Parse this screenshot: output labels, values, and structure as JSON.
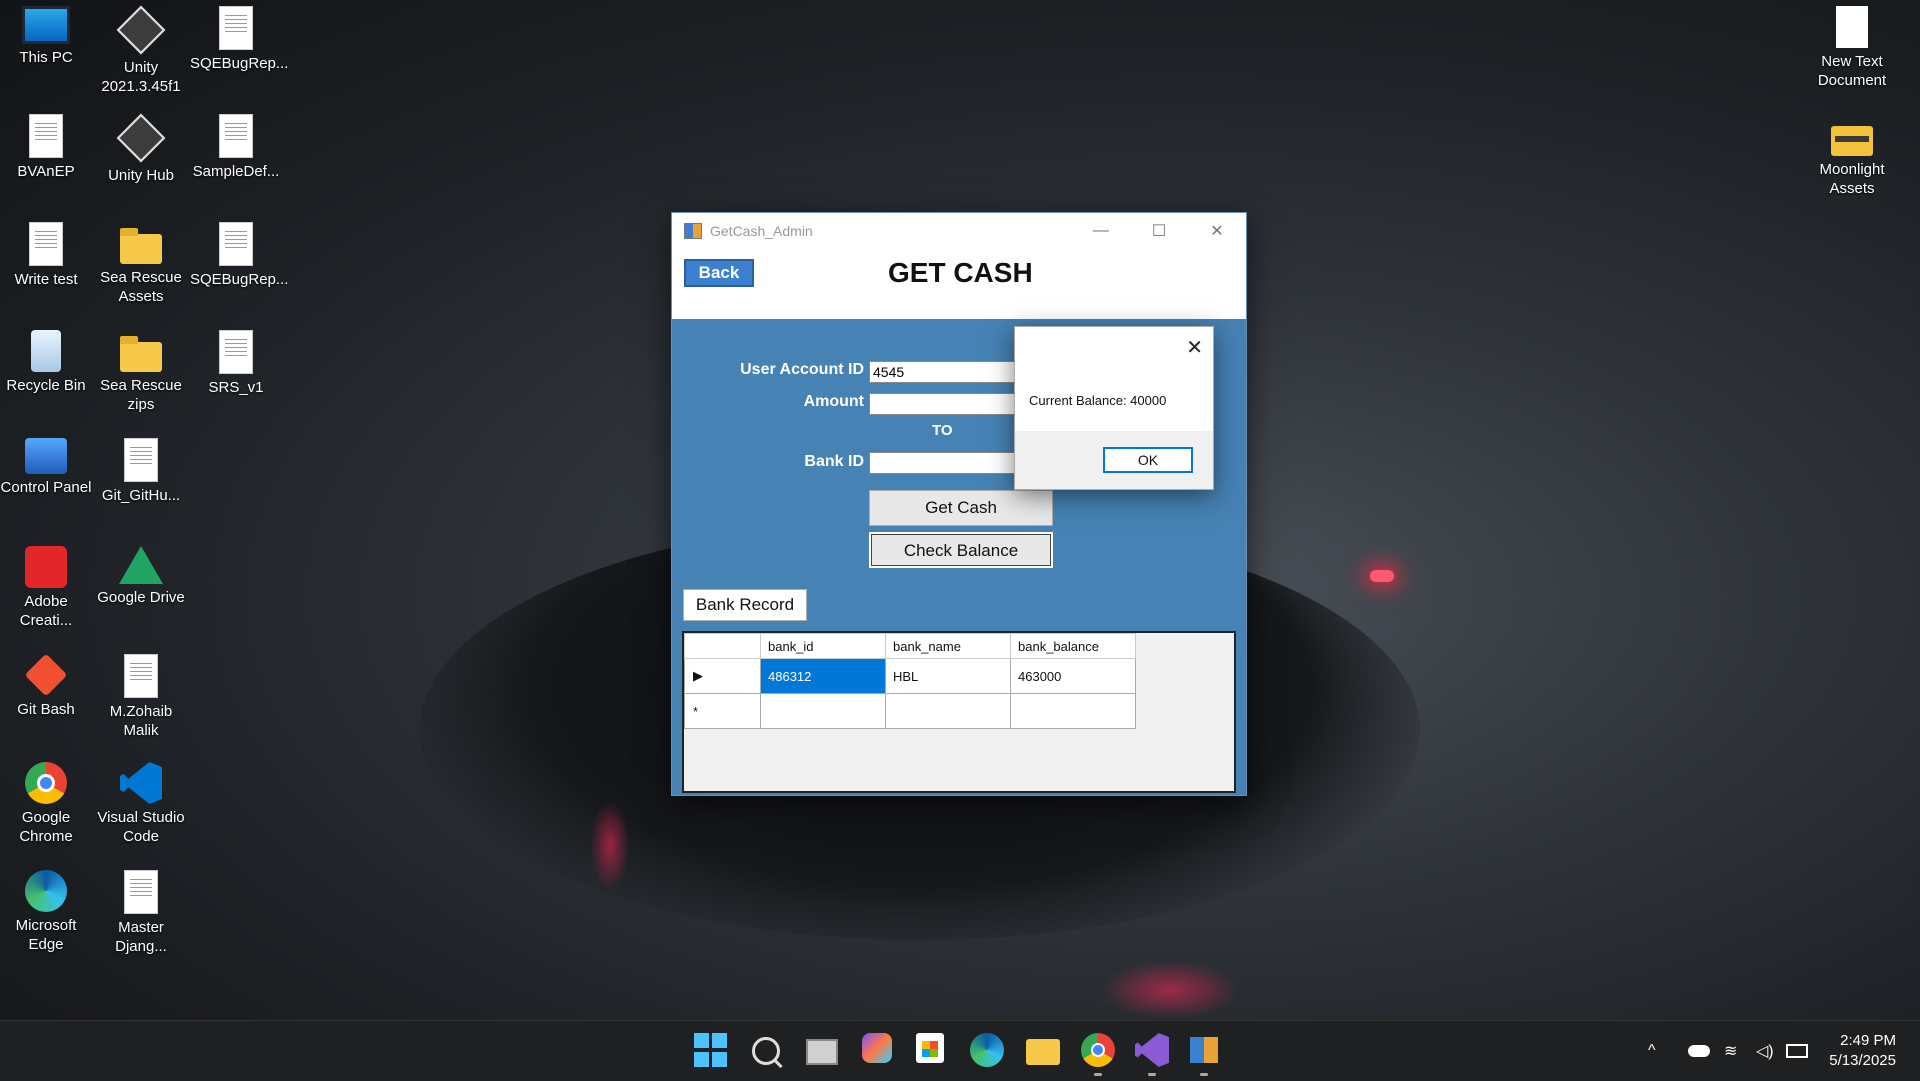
{
  "desktop": {
    "icons": [
      {
        "label": "This PC"
      },
      {
        "label": "Unity 2021.3.45f1"
      },
      {
        "label": "SQEBugRep..."
      },
      {
        "label": "BVAnEP"
      },
      {
        "label": "Unity Hub"
      },
      {
        "label": "SampleDef..."
      },
      {
        "label": "Write test"
      },
      {
        "label": "Sea Rescue Assets"
      },
      {
        "label": "SQEBugRep..."
      },
      {
        "label": "Recycle Bin"
      },
      {
        "label": "Sea Rescue zips"
      },
      {
        "label": "SRS_v1"
      },
      {
        "label": "Control Panel"
      },
      {
        "label": "Git_GitHu..."
      },
      {
        "label": "Adobe Creati..."
      },
      {
        "label": "Google Drive"
      },
      {
        "label": "Git Bash"
      },
      {
        "label": "M.Zohaib Malik"
      },
      {
        "label": "Google Chrome"
      },
      {
        "label": "Visual Studio Code"
      },
      {
        "label": "Microsoft Edge"
      },
      {
        "label": "Master Djang..."
      },
      {
        "label": "New Text Document"
      },
      {
        "label": "Moonlight Assets"
      }
    ]
  },
  "window": {
    "title": "GetCash_Admin",
    "minimize": "—",
    "maximize": "☐",
    "close": "✕",
    "back_label": "Back",
    "heading": "GET CASH",
    "user_account_label": "User Account ID",
    "user_account_value": "4545",
    "amount_label": "Amount",
    "amount_value": "",
    "to_label": "TO",
    "bank_id_label": "Bank ID",
    "bank_id_value": "",
    "get_cash_label": "Get Cash",
    "check_balance_label": "Check Balance",
    "bank_record_label": "Bank Record",
    "grid": {
      "columns": [
        "bank_id",
        "bank_name",
        "bank_balance"
      ],
      "rows": [
        {
          "marker": "▶",
          "cells": [
            "486312",
            "HBL",
            "463000"
          ]
        },
        {
          "marker": "*",
          "cells": [
            "",
            "",
            ""
          ]
        }
      ]
    }
  },
  "messagebox": {
    "close": "✕",
    "text": "Current Balance: 40000",
    "ok_label": "OK"
  },
  "taskbar": {
    "tray_chevron": "^",
    "time": "2:49 PM",
    "date": "5/13/2025"
  },
  "colors": {
    "panel_blue": "#4682b4",
    "selection_blue": "#0078d7",
    "start_blue": "#4cc2ff"
  }
}
